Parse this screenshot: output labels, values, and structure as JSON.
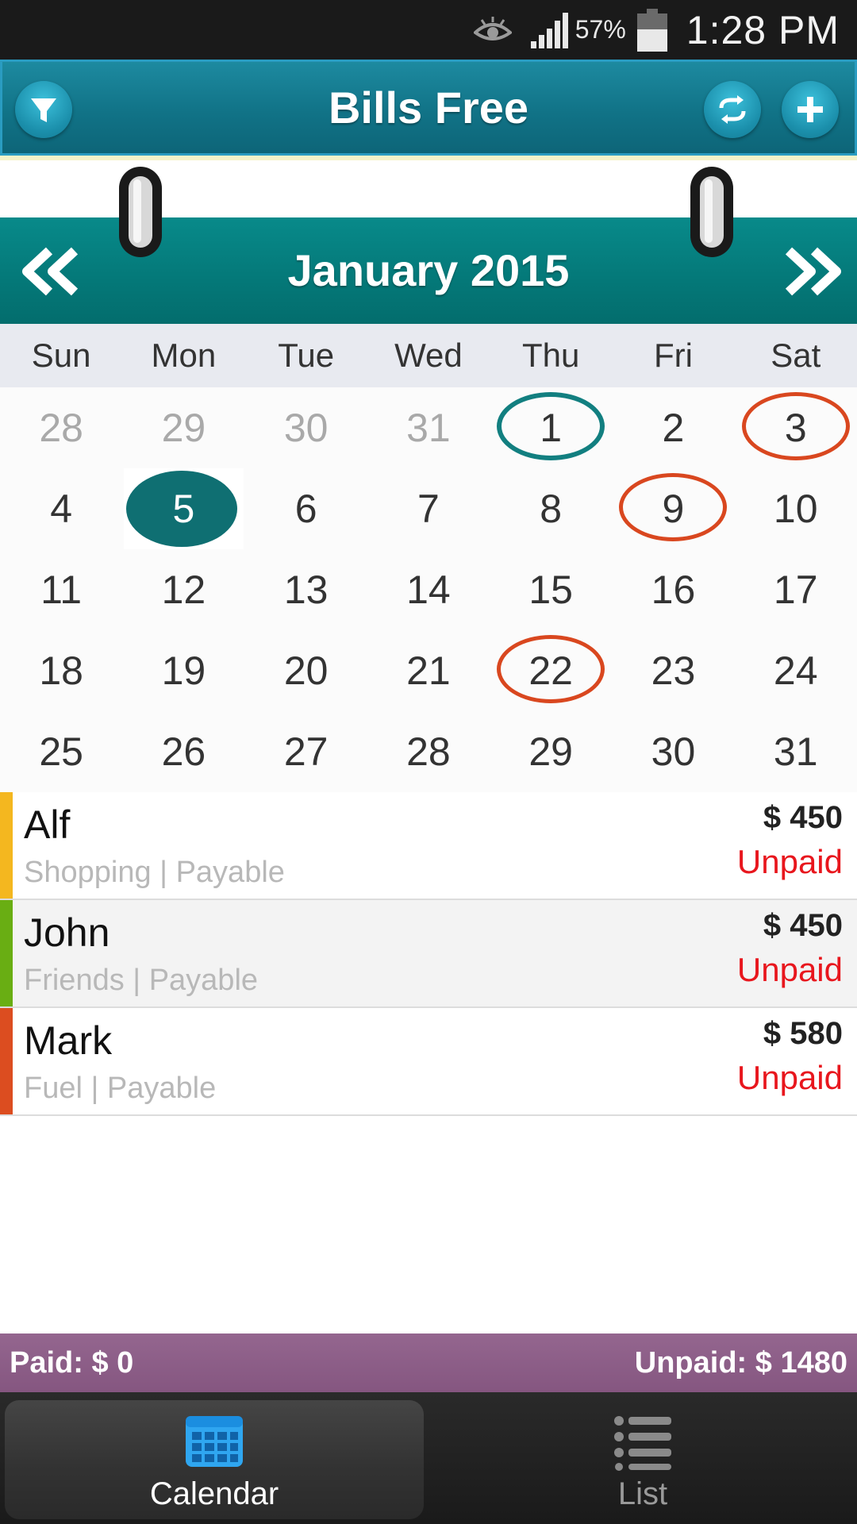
{
  "status_bar": {
    "battery_percent": "57%",
    "time": "1:28 PM"
  },
  "header": {
    "title": "Bills Free",
    "icons": [
      "filter-icon",
      "sync-icon",
      "add-icon"
    ]
  },
  "calendar": {
    "month_title": "January 2015",
    "prev_icon": "double-chevron-left-icon",
    "next_icon": "double-chevron-right-icon",
    "weekdays": [
      "Sun",
      "Mon",
      "Tue",
      "Wed",
      "Thu",
      "Fri",
      "Sat"
    ],
    "weeks": [
      [
        {
          "d": "28",
          "other": true
        },
        {
          "d": "29",
          "other": true
        },
        {
          "d": "30",
          "other": true
        },
        {
          "d": "31",
          "other": true
        },
        {
          "d": "1",
          "mark": "teal"
        },
        {
          "d": "2"
        },
        {
          "d": "3",
          "mark": "orange"
        }
      ],
      [
        {
          "d": "4"
        },
        {
          "d": "5",
          "mark": "filled"
        },
        {
          "d": "6"
        },
        {
          "d": "7"
        },
        {
          "d": "8"
        },
        {
          "d": "9",
          "mark": "orange"
        },
        {
          "d": "10"
        }
      ],
      [
        {
          "d": "11"
        },
        {
          "d": "12"
        },
        {
          "d": "13"
        },
        {
          "d": "14"
        },
        {
          "d": "15"
        },
        {
          "d": "16"
        },
        {
          "d": "17"
        }
      ],
      [
        {
          "d": "18"
        },
        {
          "d": "19"
        },
        {
          "d": "20"
        },
        {
          "d": "21"
        },
        {
          "d": "22",
          "mark": "orange"
        },
        {
          "d": "23"
        },
        {
          "d": "24"
        }
      ],
      [
        {
          "d": "25"
        },
        {
          "d": "26"
        },
        {
          "d": "27"
        },
        {
          "d": "28"
        },
        {
          "d": "29"
        },
        {
          "d": "30"
        },
        {
          "d": "31"
        }
      ]
    ],
    "colors": {
      "today": "#127f80",
      "due": "#d9471f",
      "selected": "#0f6f72"
    }
  },
  "bills": [
    {
      "name": "Alf",
      "details": "Shopping | Payable",
      "amount": "$ 450",
      "status": "Unpaid",
      "color": "#f4b71f"
    },
    {
      "name": "John",
      "details": "Friends | Payable",
      "amount": "$ 450",
      "status": "Unpaid",
      "color": "#69ae13"
    },
    {
      "name": "Mark",
      "details": "Fuel | Payable",
      "amount": "$ 580",
      "status": "Unpaid",
      "color": "#dc4d20"
    }
  ],
  "summary": {
    "paid": "Paid: $ 0",
    "unpaid": "Unpaid: $ 1480"
  },
  "tabs": {
    "calendar": {
      "label": "Calendar",
      "icon": "calendar-grid-icon"
    },
    "list": {
      "label": "List",
      "icon": "list-icon"
    }
  }
}
